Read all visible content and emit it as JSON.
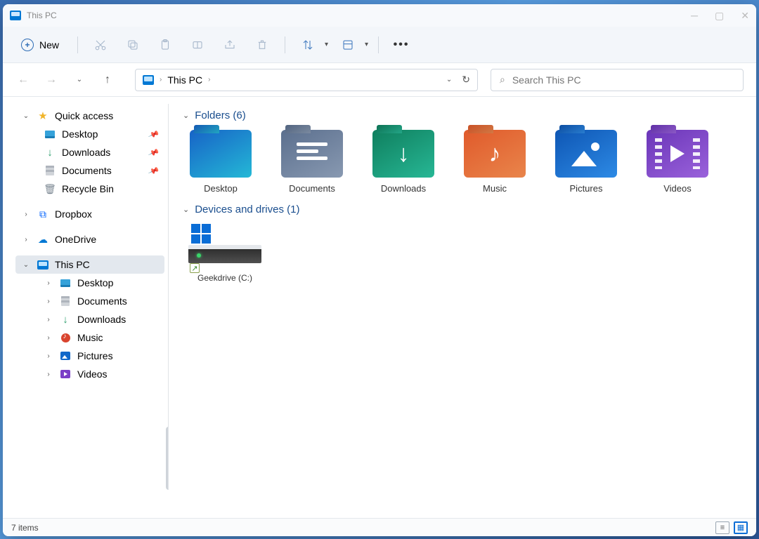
{
  "window": {
    "title": "This PC"
  },
  "toolbar": {
    "new_label": "New"
  },
  "breadcrumb": {
    "root": "This PC"
  },
  "search": {
    "placeholder": "Search This PC"
  },
  "sidebar": {
    "quick_access": "Quick access",
    "quick_items": [
      {
        "label": "Desktop"
      },
      {
        "label": "Downloads"
      },
      {
        "label": "Documents"
      },
      {
        "label": "Recycle Bin"
      }
    ],
    "dropbox": "Dropbox",
    "onedrive": "OneDrive",
    "this_pc": "This PC",
    "pc_items": [
      {
        "label": "Desktop"
      },
      {
        "label": "Documents"
      },
      {
        "label": "Downloads"
      },
      {
        "label": "Music"
      },
      {
        "label": "Pictures"
      },
      {
        "label": "Videos"
      }
    ]
  },
  "content": {
    "folders_header": "Folders (6)",
    "folders": [
      {
        "label": "Desktop"
      },
      {
        "label": "Documents"
      },
      {
        "label": "Downloads"
      },
      {
        "label": "Music"
      },
      {
        "label": "Pictures"
      },
      {
        "label": "Videos"
      }
    ],
    "drives_header": "Devices and drives (1)",
    "drive_label": "Geekdrive (C:)"
  },
  "status": {
    "item_count": "7 items"
  }
}
